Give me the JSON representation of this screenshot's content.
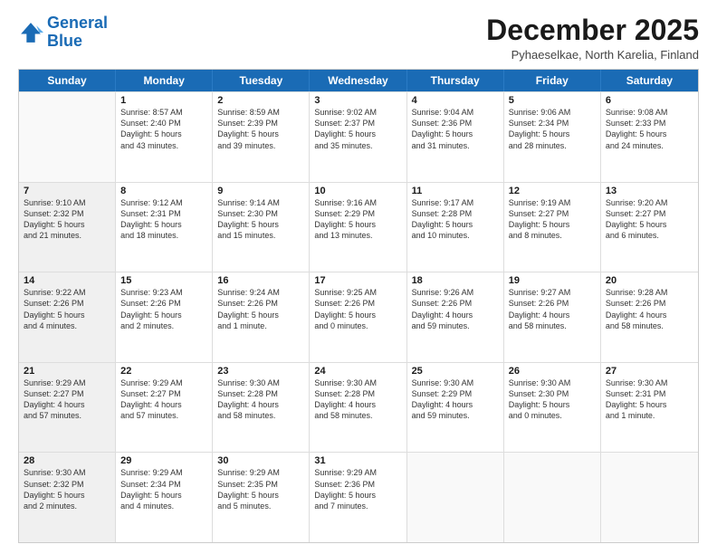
{
  "header": {
    "logo_line1": "General",
    "logo_line2": "Blue",
    "month": "December 2025",
    "location": "Pyhaeselkae, North Karelia, Finland"
  },
  "weekdays": [
    "Sunday",
    "Monday",
    "Tuesday",
    "Wednesday",
    "Thursday",
    "Friday",
    "Saturday"
  ],
  "rows": [
    [
      {
        "day": "",
        "text": "",
        "empty": true
      },
      {
        "day": "1",
        "text": "Sunrise: 8:57 AM\nSunset: 2:40 PM\nDaylight: 5 hours\nand 43 minutes."
      },
      {
        "day": "2",
        "text": "Sunrise: 8:59 AM\nSunset: 2:39 PM\nDaylight: 5 hours\nand 39 minutes."
      },
      {
        "day": "3",
        "text": "Sunrise: 9:02 AM\nSunset: 2:37 PM\nDaylight: 5 hours\nand 35 minutes."
      },
      {
        "day": "4",
        "text": "Sunrise: 9:04 AM\nSunset: 2:36 PM\nDaylight: 5 hours\nand 31 minutes."
      },
      {
        "day": "5",
        "text": "Sunrise: 9:06 AM\nSunset: 2:34 PM\nDaylight: 5 hours\nand 28 minutes."
      },
      {
        "day": "6",
        "text": "Sunrise: 9:08 AM\nSunset: 2:33 PM\nDaylight: 5 hours\nand 24 minutes."
      }
    ],
    [
      {
        "day": "7",
        "text": "Sunrise: 9:10 AM\nSunset: 2:32 PM\nDaylight: 5 hours\nand 21 minutes.",
        "shaded": true
      },
      {
        "day": "8",
        "text": "Sunrise: 9:12 AM\nSunset: 2:31 PM\nDaylight: 5 hours\nand 18 minutes."
      },
      {
        "day": "9",
        "text": "Sunrise: 9:14 AM\nSunset: 2:30 PM\nDaylight: 5 hours\nand 15 minutes."
      },
      {
        "day": "10",
        "text": "Sunrise: 9:16 AM\nSunset: 2:29 PM\nDaylight: 5 hours\nand 13 minutes."
      },
      {
        "day": "11",
        "text": "Sunrise: 9:17 AM\nSunset: 2:28 PM\nDaylight: 5 hours\nand 10 minutes."
      },
      {
        "day": "12",
        "text": "Sunrise: 9:19 AM\nSunset: 2:27 PM\nDaylight: 5 hours\nand 8 minutes."
      },
      {
        "day": "13",
        "text": "Sunrise: 9:20 AM\nSunset: 2:27 PM\nDaylight: 5 hours\nand 6 minutes."
      }
    ],
    [
      {
        "day": "14",
        "text": "Sunrise: 9:22 AM\nSunset: 2:26 PM\nDaylight: 5 hours\nand 4 minutes.",
        "shaded": true
      },
      {
        "day": "15",
        "text": "Sunrise: 9:23 AM\nSunset: 2:26 PM\nDaylight: 5 hours\nand 2 minutes."
      },
      {
        "day": "16",
        "text": "Sunrise: 9:24 AM\nSunset: 2:26 PM\nDaylight: 5 hours\nand 1 minute."
      },
      {
        "day": "17",
        "text": "Sunrise: 9:25 AM\nSunset: 2:26 PM\nDaylight: 5 hours\nand 0 minutes."
      },
      {
        "day": "18",
        "text": "Sunrise: 9:26 AM\nSunset: 2:26 PM\nDaylight: 4 hours\nand 59 minutes."
      },
      {
        "day": "19",
        "text": "Sunrise: 9:27 AM\nSunset: 2:26 PM\nDaylight: 4 hours\nand 58 minutes."
      },
      {
        "day": "20",
        "text": "Sunrise: 9:28 AM\nSunset: 2:26 PM\nDaylight: 4 hours\nand 58 minutes."
      }
    ],
    [
      {
        "day": "21",
        "text": "Sunrise: 9:29 AM\nSunset: 2:27 PM\nDaylight: 4 hours\nand 57 minutes.",
        "shaded": true
      },
      {
        "day": "22",
        "text": "Sunrise: 9:29 AM\nSunset: 2:27 PM\nDaylight: 4 hours\nand 57 minutes."
      },
      {
        "day": "23",
        "text": "Sunrise: 9:30 AM\nSunset: 2:28 PM\nDaylight: 4 hours\nand 58 minutes."
      },
      {
        "day": "24",
        "text": "Sunrise: 9:30 AM\nSunset: 2:28 PM\nDaylight: 4 hours\nand 58 minutes."
      },
      {
        "day": "25",
        "text": "Sunrise: 9:30 AM\nSunset: 2:29 PM\nDaylight: 4 hours\nand 59 minutes."
      },
      {
        "day": "26",
        "text": "Sunrise: 9:30 AM\nSunset: 2:30 PM\nDaylight: 5 hours\nand 0 minutes."
      },
      {
        "day": "27",
        "text": "Sunrise: 9:30 AM\nSunset: 2:31 PM\nDaylight: 5 hours\nand 1 minute."
      }
    ],
    [
      {
        "day": "28",
        "text": "Sunrise: 9:30 AM\nSunset: 2:32 PM\nDaylight: 5 hours\nand 2 minutes.",
        "shaded": true
      },
      {
        "day": "29",
        "text": "Sunrise: 9:29 AM\nSunset: 2:34 PM\nDaylight: 5 hours\nand 4 minutes."
      },
      {
        "day": "30",
        "text": "Sunrise: 9:29 AM\nSunset: 2:35 PM\nDaylight: 5 hours\nand 5 minutes."
      },
      {
        "day": "31",
        "text": "Sunrise: 9:29 AM\nSunset: 2:36 PM\nDaylight: 5 hours\nand 7 minutes."
      },
      {
        "day": "",
        "text": "",
        "empty": true
      },
      {
        "day": "",
        "text": "",
        "empty": true
      },
      {
        "day": "",
        "text": "",
        "empty": true
      }
    ]
  ]
}
